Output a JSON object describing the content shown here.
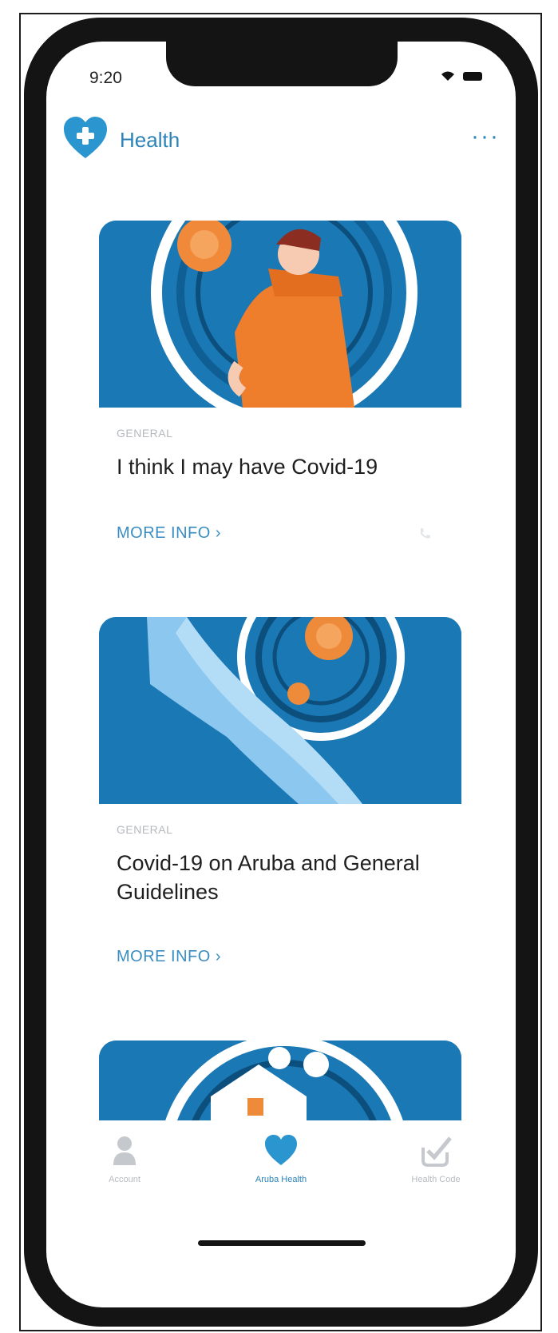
{
  "status_bar": {
    "time": "9:20"
  },
  "header": {
    "title": "Health",
    "more": "···"
  },
  "cards": [
    {
      "category": "GENERAL",
      "title": "I think I may have Covid-19",
      "more_info": "MORE INFO ›"
    },
    {
      "category": "GENERAL",
      "title": "Covid-19 on Aruba and General Guidelines",
      "more_info": "MORE INFO ›"
    }
  ],
  "tabbar": {
    "items": [
      {
        "label": "Account",
        "icon": "person-icon",
        "active": false
      },
      {
        "label": "Aruba Health",
        "icon": "heart-icon",
        "active": true
      },
      {
        "label": "Health Code",
        "icon": "checkmark-icon",
        "active": false
      }
    ]
  },
  "colors": {
    "accent": "#2b83b8",
    "card_bg": "#1a78b5",
    "illustration_orange": "#ee7d2c",
    "frame": "#141414"
  }
}
